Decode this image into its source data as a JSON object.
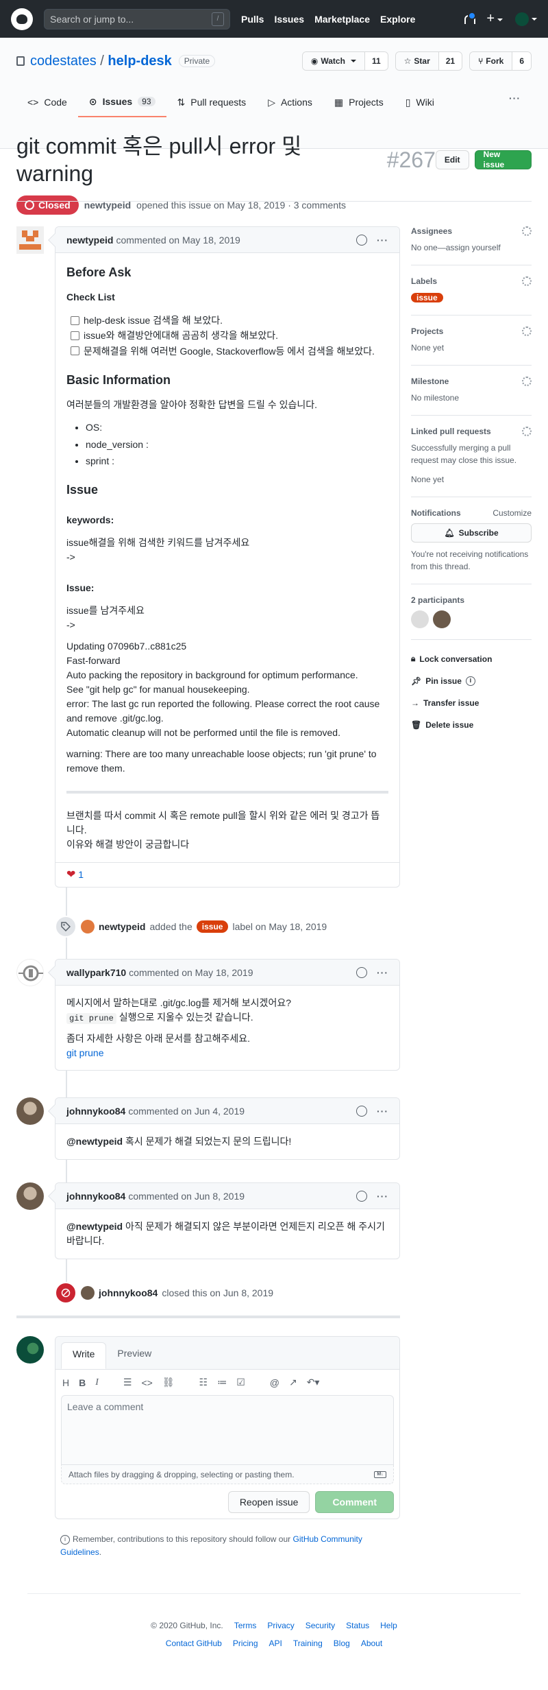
{
  "header": {
    "search_placeholder": "Search or jump to...",
    "slash_key": "/",
    "nav": [
      "Pulls",
      "Issues",
      "Marketplace",
      "Explore"
    ]
  },
  "repo": {
    "owner": "codestates",
    "separator": "/",
    "name": "help-desk",
    "visibility": "Private",
    "watch_label": "Watch",
    "watch_count": "11",
    "star_label": "Star",
    "star_count": "21",
    "fork_label": "Fork",
    "fork_count": "6",
    "tabs": [
      {
        "label": "Code",
        "icon": "code-icon"
      },
      {
        "label": "Issues",
        "icon": "issue-opened-icon",
        "count": "93"
      },
      {
        "label": "Pull requests",
        "icon": "git-pull-request-icon"
      },
      {
        "label": "Actions",
        "icon": "play-icon"
      },
      {
        "label": "Projects",
        "icon": "project-icon"
      },
      {
        "label": "Wiki",
        "icon": "book-icon"
      }
    ],
    "more": "···"
  },
  "issue": {
    "title": "git commit 혹은 pull시 error 및 warning",
    "number": "#267",
    "edit_label": "Edit",
    "new_issue_label": "New issue",
    "state": "Closed",
    "author": "newtypeid",
    "opened_text": "opened this issue on May 18, 2019 · 3 comments"
  },
  "comments": {
    "c1": {
      "author": "newtypeid",
      "meta": "commented on May 18, 2019",
      "h_before": "Before Ask",
      "h_checklist": "Check List",
      "checklist": [
        "help-desk issue 검색을 해 보았다.",
        "issue와 해결방안에대해 곰곰히 생각을 해보았다.",
        "문제해결을 위해 여러번 Google, Stackoverflow등 에서 검색을 해보았다."
      ],
      "h_basic": "Basic Information",
      "basic_intro": "여러분들의 개발환경을 알아야 정확한 답변을 드릴 수 있습니다.",
      "basic_list": [
        "OS:",
        "node_version :",
        "sprint :"
      ],
      "h_issue": "Issue",
      "h_keywords": "keywords:",
      "keywords_1": "issue해결을 위해 검색한 키워드를 남겨주세요",
      "keywords_2": "->",
      "h_issue2": "Issue:",
      "issue_1": "issue를 남겨주세요",
      "issue_2": "->",
      "log": [
        "Updating 07096b7..c881c25",
        "Fast-forward",
        "Auto packing the repository in background for optimum performance.",
        "See \"git help gc\" for manual housekeeping.",
        "error: The last gc run reported the following. Please correct the root cause and remove .git/gc.log.",
        "Automatic cleanup will not be performed until the file is removed."
      ],
      "warning": "warning: There are too many unreachable loose objects; run 'git prune' to remove them.",
      "outro_1": "브랜치를 따서 commit 시 혹은 remote pull을 할시 위와 같은 에러 및 경고가 뜹니다.",
      "outro_2": "이유와 해결 방안이 궁금합니다",
      "reaction_icon": "heart-icon",
      "reaction_count": "1"
    },
    "label_event": {
      "actor": "newtypeid",
      "pre": "added the",
      "label": "issue",
      "post": "label on May 18, 2019"
    },
    "c2": {
      "author": "wallypark710",
      "meta": "commented on May 18, 2019",
      "line1": "메시지에서 말하는대로 .git/gc.log를 제거해 보시겠어요?",
      "code": "git prune",
      "line2": " 실행으로 지울수 있는것 같습니다.",
      "line3": "좀더 자세한 사항은 아래 문서를 참고해주세요.",
      "link": "git prune"
    },
    "c3": {
      "author": "johnnykoo84",
      "meta": "commented on Jun 4, 2019",
      "mention": "@newtypeid",
      "text": " 혹시 문제가 해결 되었는지 문의 드립니다!"
    },
    "c4": {
      "author": "johnnykoo84",
      "meta": "commented on Jun 8, 2019",
      "mention": "@newtypeid",
      "text": " 아직 문제가 해결되지 않은 부분이라면 언제든지 리오픈 해 주시기 바랍니다."
    },
    "close_event": {
      "actor": "johnnykoo84",
      "text": "closed this on Jun 8, 2019"
    }
  },
  "sidebar": {
    "assignees_title": "Assignees",
    "assignees_value": "No one—assign yourself",
    "labels_title": "Labels",
    "label_chip": "issue",
    "projects_title": "Projects",
    "projects_value": "None yet",
    "milestone_title": "Milestone",
    "milestone_value": "No milestone",
    "linked_title": "Linked pull requests",
    "linked_desc": "Successfully merging a pull request may close this issue.",
    "linked_value": "None yet",
    "notifications_title": "Notifications",
    "customize": "Customize",
    "subscribe": "Subscribe",
    "notif_desc": "You're not receiving notifications from this thread.",
    "participants_title": "2 participants",
    "lock": "Lock conversation",
    "pin": "Pin issue",
    "transfer": "Transfer issue",
    "delete": "Delete issue"
  },
  "form": {
    "tab_write": "Write",
    "tab_preview": "Preview",
    "toolbar": [
      "H",
      "B",
      "I"
    ],
    "placeholder": "Leave a comment",
    "attach": "Attach files by dragging & dropping, selecting or pasting them.",
    "md_badge": "M↓",
    "reopen": "Reopen issue",
    "comment": "Comment",
    "remember_pre": "Remember, contributions to this repository should follow our ",
    "remember_link": "GitHub Community Guidelines",
    "remember_post": "."
  },
  "footer": {
    "copyright": "© 2020 GitHub, Inc.",
    "row1": [
      "Terms",
      "Privacy",
      "Security",
      "Status",
      "Help"
    ],
    "row2": [
      "Contact GitHub",
      "Pricing",
      "API",
      "Training",
      "Blog",
      "About"
    ]
  },
  "colors": {
    "closed": "#d73a49",
    "label_issue": "#d93f0b",
    "primary": "#2ea44f"
  }
}
